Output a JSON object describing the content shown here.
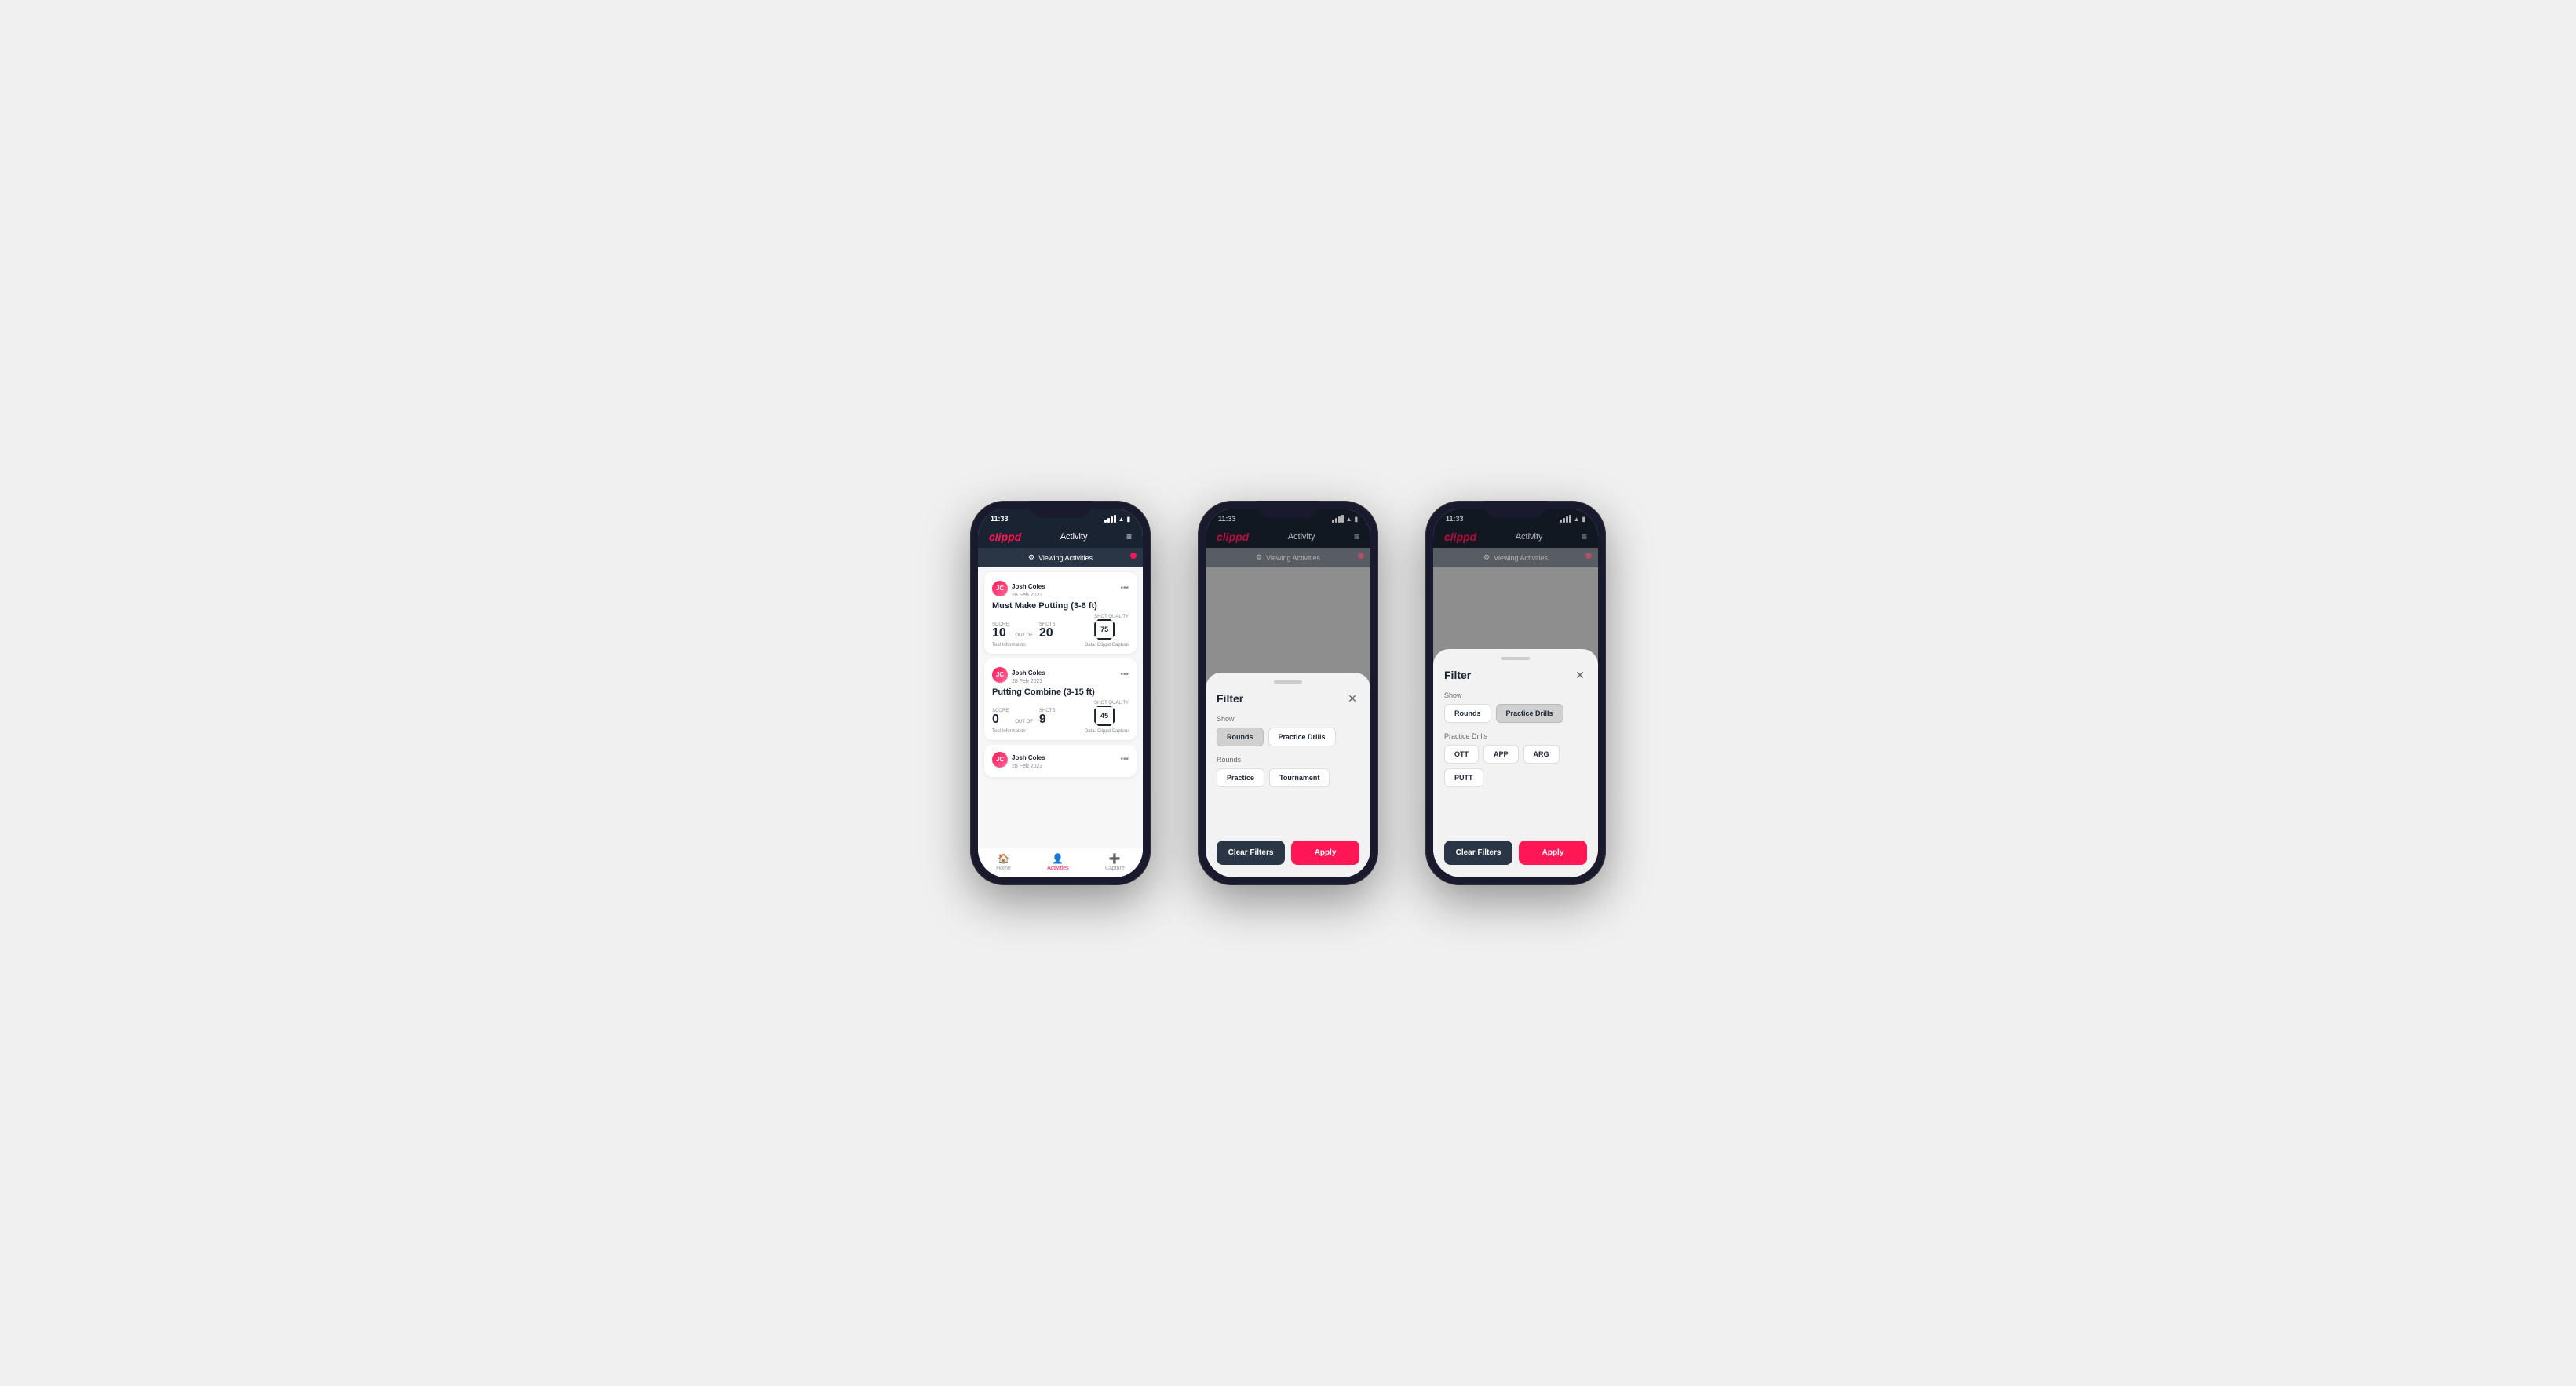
{
  "app": {
    "logo": "clippd",
    "nav_title": "Activity",
    "time": "11:33"
  },
  "viewing_bar": {
    "label": "Viewing Activities"
  },
  "phone1": {
    "cards": [
      {
        "user_name": "Josh Coles",
        "user_date": "28 Feb 2023",
        "activity_title": "Must Make Putting (3-6 ft)",
        "score_label": "Score",
        "score_value": "10",
        "shots_label": "Shots",
        "out_of": "OUT OF",
        "shots_value": "20",
        "shot_quality_label": "Shot Quality",
        "shot_quality_value": "75",
        "test_info": "Test Information",
        "data_source": "Data: Clippd Capture"
      },
      {
        "user_name": "Josh Coles",
        "user_date": "28 Feb 2023",
        "activity_title": "Putting Combine (3-15 ft)",
        "score_label": "Score",
        "score_value": "0",
        "shots_label": "Shots",
        "out_of": "OUT OF",
        "shots_value": "9",
        "shot_quality_label": "Shot Quality",
        "shot_quality_value": "45",
        "test_info": "Test Information",
        "data_source": "Data: Clippd Capture"
      },
      {
        "user_name": "Josh Coles",
        "user_date": "28 Feb 2023",
        "activity_title": "",
        "score_label": "",
        "score_value": "",
        "shots_label": "",
        "out_of": "",
        "shots_value": "",
        "shot_quality_label": "",
        "shot_quality_value": "",
        "test_info": "",
        "data_source": ""
      }
    ],
    "bottom_nav": [
      {
        "label": "Home",
        "icon": "🏠",
        "active": false
      },
      {
        "label": "Activities",
        "icon": "👤",
        "active": true
      },
      {
        "label": "Capture",
        "icon": "➕",
        "active": false
      }
    ]
  },
  "phone2": {
    "filter": {
      "title": "Filter",
      "show_label": "Show",
      "show_buttons": [
        {
          "label": "Rounds",
          "active": true
        },
        {
          "label": "Practice Drills",
          "active": false
        }
      ],
      "rounds_label": "Rounds",
      "rounds_buttons": [
        {
          "label": "Practice",
          "active": false
        },
        {
          "label": "Tournament",
          "active": false
        }
      ],
      "clear_label": "Clear Filters",
      "apply_label": "Apply"
    }
  },
  "phone3": {
    "filter": {
      "title": "Filter",
      "show_label": "Show",
      "show_buttons": [
        {
          "label": "Rounds",
          "active": false
        },
        {
          "label": "Practice Drills",
          "active": true
        }
      ],
      "drills_label": "Practice Drills",
      "drills_buttons": [
        {
          "label": "OTT",
          "active": false
        },
        {
          "label": "APP",
          "active": false
        },
        {
          "label": "ARG",
          "active": false
        },
        {
          "label": "PUTT",
          "active": false
        }
      ],
      "clear_label": "Clear Filters",
      "apply_label": "Apply"
    }
  }
}
